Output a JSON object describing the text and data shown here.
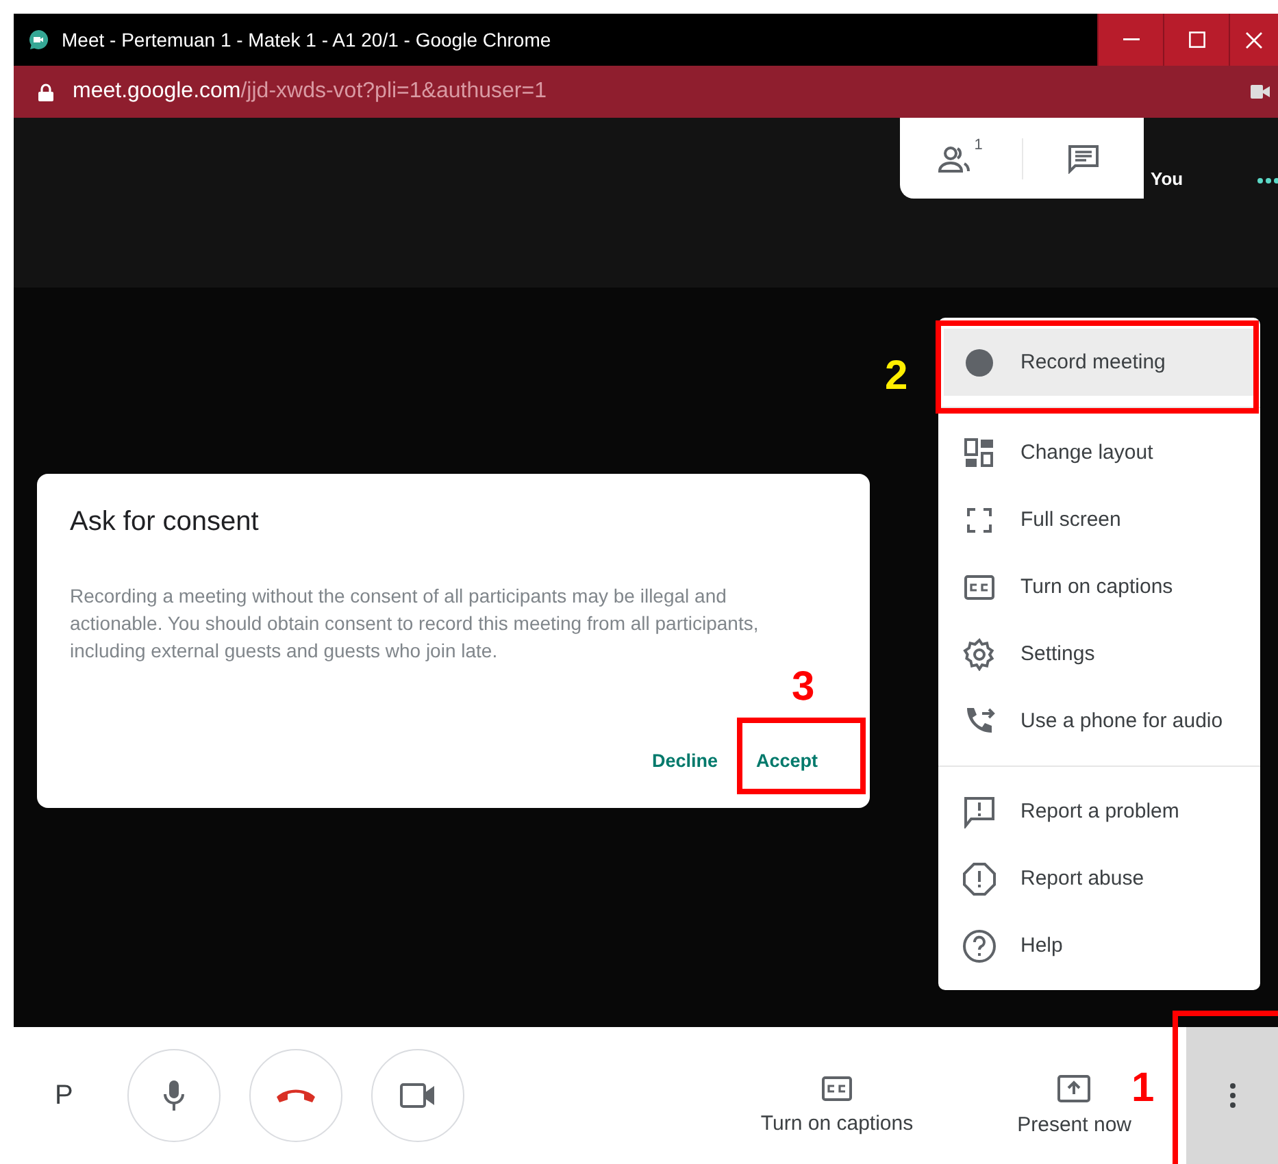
{
  "window": {
    "title": "Meet - Pertemuan 1 - Matek 1 - A1 20/1 - Google Chrome"
  },
  "address_bar": {
    "host": "meet.google.com",
    "path": "/jjd-xwds-vot?pli=1&authuser=1"
  },
  "top_panel": {
    "participant_count": "1",
    "self_label": "You"
  },
  "dialog": {
    "title": "Ask for consent",
    "body": "Recording a meeting without the consent of all participants may be illegal and actionable. You should obtain consent to record this meeting from all participants, including external guests and guests who join late.",
    "buttons": [
      {
        "label": "Decline"
      },
      {
        "label": "Accept"
      }
    ]
  },
  "menu": {
    "groups": [
      [
        {
          "label": "Record meeting",
          "kind": "record",
          "selected": true
        }
      ],
      [
        {
          "label": "Change layout",
          "kind": "layout",
          "selected": false
        },
        {
          "label": "Full screen",
          "kind": "fullscreen",
          "selected": false
        },
        {
          "label": "Turn on captions",
          "kind": "captions",
          "selected": false
        },
        {
          "label": "Settings",
          "kind": "settings",
          "selected": false
        },
        {
          "label": "Use a phone for audio",
          "kind": "phone",
          "selected": false
        }
      ],
      [
        {
          "label": "Report a problem",
          "kind": "problem",
          "selected": false
        },
        {
          "label": "Report abuse",
          "kind": "abuse",
          "selected": false
        },
        {
          "label": "Help",
          "kind": "help",
          "selected": false
        }
      ]
    ]
  },
  "toolbar": {
    "name_initial": "P",
    "captions_label": "Turn on captions",
    "present_label": "Present now",
    "more_active": true
  },
  "annotations": [
    {
      "label": "1",
      "color": "#ff0000"
    },
    {
      "label": "2",
      "color": "#ffee00"
    },
    {
      "label": "3",
      "color": "#ff0000"
    }
  ]
}
